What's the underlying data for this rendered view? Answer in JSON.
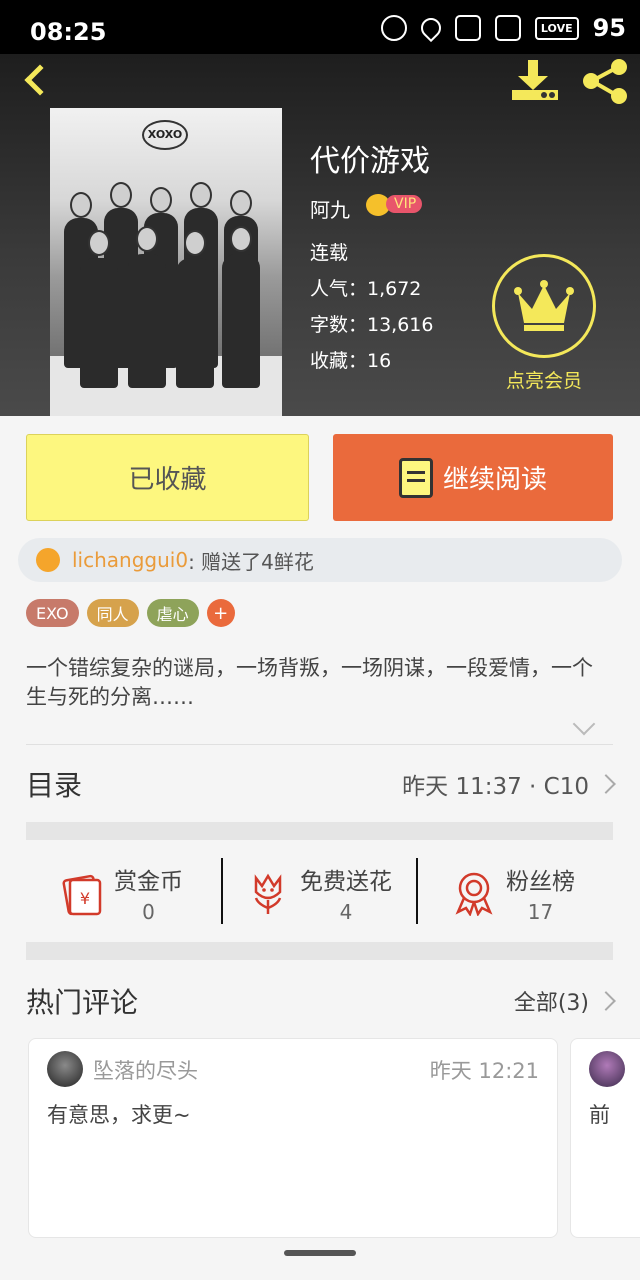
{
  "status_bar": {
    "time": "08:25",
    "battery": "95",
    "love_label": "LOVE"
  },
  "book": {
    "title": "代价游戏",
    "author": "阿九",
    "vip_label": "VIP",
    "cover_logo": "XOXO",
    "status": "连载",
    "popularity": "人气：1,672",
    "word_count": "字数：13,616",
    "favorites": "收藏：16"
  },
  "member": {
    "label": "点亮会员"
  },
  "actions": {
    "favorited_label": "已收藏",
    "continue_label": "继续阅读"
  },
  "gift": {
    "user": "lichanggui0",
    "text": " : 赠送了4鲜花"
  },
  "tags": [
    "EXO",
    "同人",
    "虐心"
  ],
  "tag_add": "+",
  "description": "一个错综复杂的谜局，一场背叛，一场阴谋，一段爱情，一个生与死的分离……",
  "toc": {
    "label": "目录",
    "update": "昨天 11:37 · C10"
  },
  "stats": [
    {
      "label": "赏金币",
      "value": "0",
      "icon": "red-envelope-icon"
    },
    {
      "label": "免费送花",
      "value": "4",
      "icon": "flower-icon"
    },
    {
      "label": "粉丝榜",
      "value": "17",
      "icon": "ribbon-medal-icon"
    }
  ],
  "comments_section": {
    "label": "热门评论",
    "all": "全部(3)"
  },
  "comments": [
    {
      "user": "坠落的尽头",
      "time": "昨天 12:21",
      "body": "有意思，求更~"
    },
    {
      "user": "",
      "time": "",
      "body": "前"
    }
  ],
  "colors": {
    "accent_yellow": "#f4e85a",
    "orange": "#ea6a3c",
    "fav_button": "#fdf77f"
  }
}
